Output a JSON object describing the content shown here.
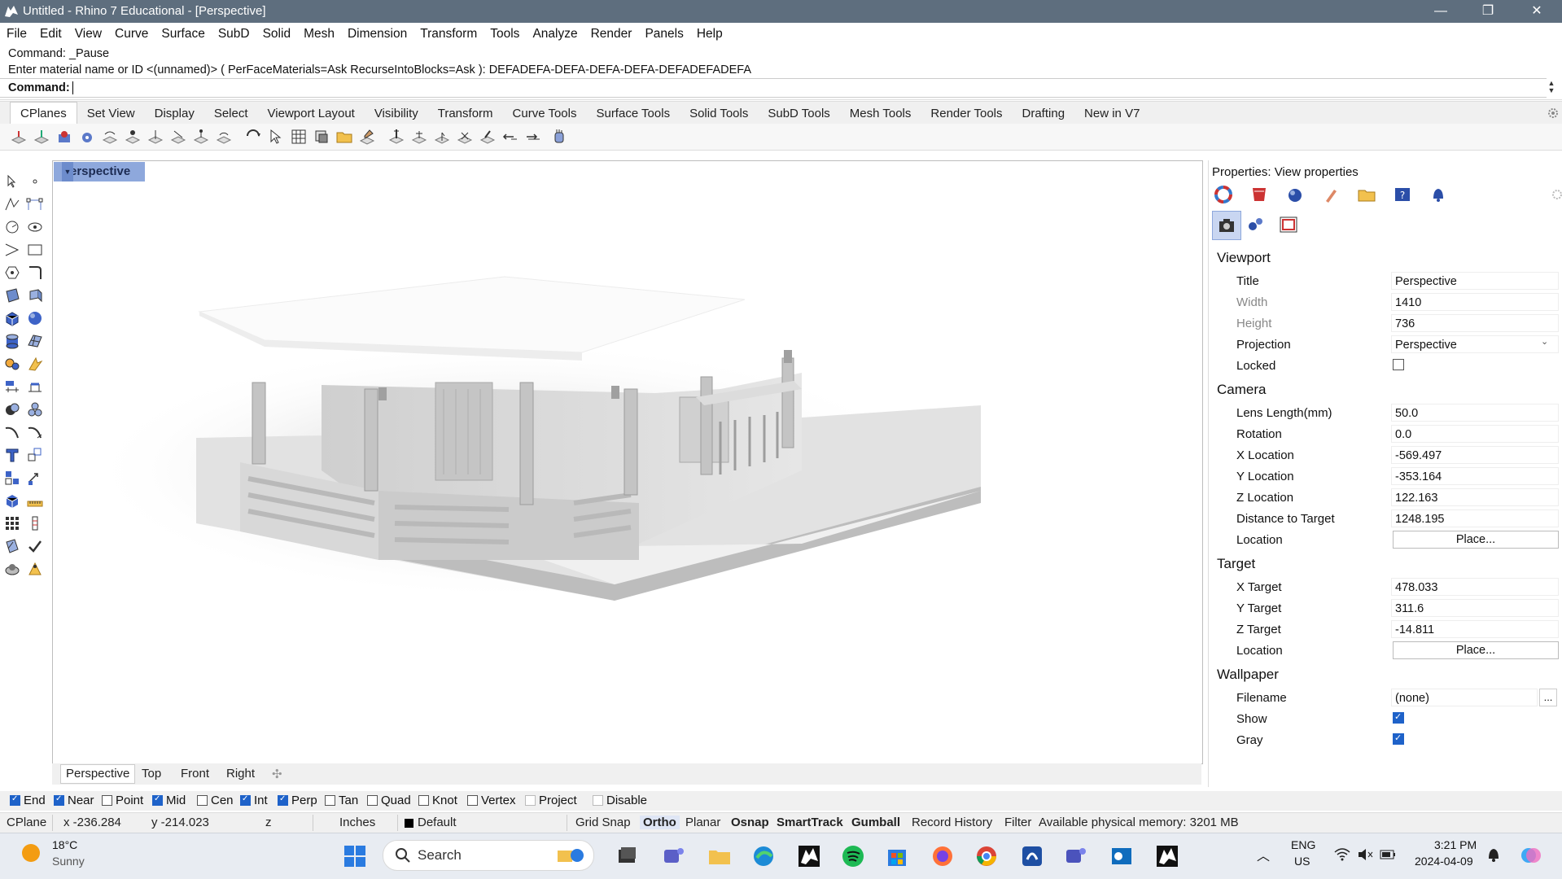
{
  "window": {
    "title": "Untitled - Rhino 7 Educational - [Perspective]",
    "controls": [
      "—",
      "❐",
      "✕"
    ]
  },
  "menu": [
    "File",
    "Edit",
    "View",
    "Curve",
    "Surface",
    "SubD",
    "Solid",
    "Mesh",
    "Dimension",
    "Transform",
    "Tools",
    "Analyze",
    "Render",
    "Panels",
    "Help"
  ],
  "command": {
    "history1": "Command: _Pause",
    "history2": "Enter material name or ID <(unnamed)> ( PerFaceMaterials=Ask  RecurseIntoBlocks=Ask ): DEFADEFA-DEFA-DEFA-DEFA-DEFADEFADEFA",
    "prompt": "Command:"
  },
  "toolbar_tabs": [
    "CPlanes",
    "Set View",
    "Display",
    "Select",
    "Viewport Layout",
    "Visibility",
    "Transform",
    "Curve Tools",
    "Surface Tools",
    "Solid Tools",
    "SubD Tools",
    "Mesh Tools",
    "Render Tools",
    "Drafting",
    "New in V7"
  ],
  "viewport": {
    "label": "Perspective",
    "bottom_tabs": [
      "Perspective",
      "Top",
      "Front",
      "Right"
    ],
    "add_tab": "✣"
  },
  "properties": {
    "title": "Properties: View properties",
    "viewport_section": "Viewport",
    "title_label": "Title",
    "title_value": "Perspective",
    "width_label": "Width",
    "width_value": "1410",
    "height_label": "Height",
    "height_value": "736",
    "projection_label": "Projection",
    "projection_value": "Perspective",
    "locked_label": "Locked",
    "camera_section": "Camera",
    "lens_label": "Lens Length(mm)",
    "lens_value": "50.0",
    "rotation_label": "Rotation",
    "rotation_value": "0.0",
    "xloc_label": "X Location",
    "xloc_value": "-569.497",
    "yloc_label": "Y Location",
    "yloc_value": "-353.164",
    "zloc_label": "Z Location",
    "zloc_value": "122.163",
    "dist_label": "Distance to Target",
    "dist_value": "1248.195",
    "cam_location_label": "Location",
    "place_button": "Place...",
    "target_section": "Target",
    "xt_label": "X Target",
    "xt_value": "478.033",
    "yt_label": "Y Target",
    "yt_value": "311.6",
    "zt_label": "Z Target",
    "zt_value": "-14.811",
    "tgt_location_label": "Location",
    "wallpaper_section": "Wallpaper",
    "filename_label": "Filename",
    "filename_value": "(none)",
    "browse": "...",
    "show_label": "Show",
    "gray_label": "Gray"
  },
  "osnap": [
    {
      "label": "End",
      "checked": true
    },
    {
      "label": "Near",
      "checked": true
    },
    {
      "label": "Point",
      "checked": false
    },
    {
      "label": "Mid",
      "checked": true
    },
    {
      "label": "Cen",
      "checked": false
    },
    {
      "label": "Int",
      "checked": true
    },
    {
      "label": "Perp",
      "checked": true
    },
    {
      "label": "Tan",
      "checked": false
    },
    {
      "label": "Quad",
      "checked": false
    },
    {
      "label": "Knot",
      "checked": false
    },
    {
      "label": "Vertex",
      "checked": false
    },
    {
      "label": "Project",
      "checked": false
    },
    {
      "label": "Disable",
      "checked": false
    }
  ],
  "status": {
    "cplane": "CPlane",
    "x": "x -236.284",
    "y": "y -214.023",
    "z": "z",
    "units": "Inches",
    "layer": "Default",
    "grid_snap": "Grid Snap",
    "ortho": "Ortho",
    "planar": "Planar",
    "osnap": "Osnap",
    "smarttrack": "SmartTrack",
    "gumball": "Gumball",
    "record_history": "Record History",
    "filter": "Filter",
    "memory": "Available physical memory: 3201 MB"
  },
  "taskbar": {
    "weather_temp": "18°C",
    "weather_desc": "Sunny",
    "search": "Search",
    "lang1": "ENG",
    "lang2": "US",
    "time": "3:21 PM",
    "date": "2024-04-09"
  },
  "colors": {
    "titlebar": "#5e6e7e",
    "viewport_label": "#8ea8dc",
    "check_blue": "#1e62c9"
  }
}
